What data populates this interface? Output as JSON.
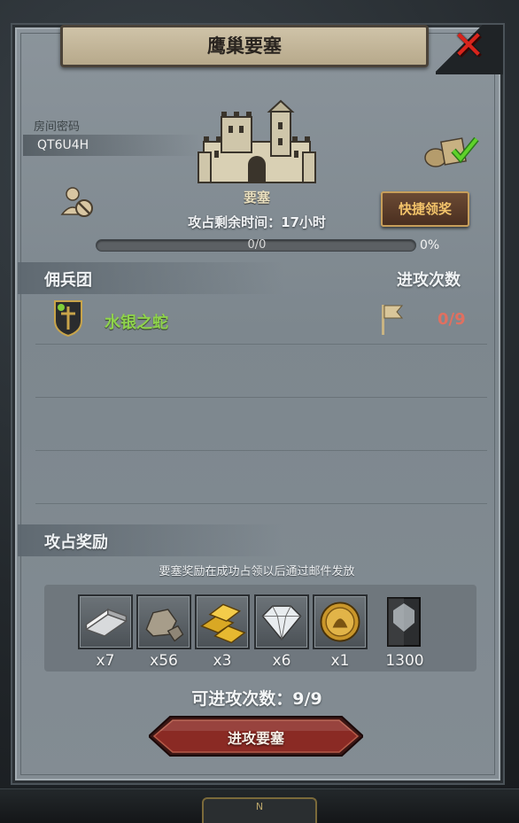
{
  "title": "鹰巢要塞",
  "room": {
    "label": "房间密码",
    "code": "QT6U4H"
  },
  "fortress": {
    "name": "要塞",
    "time_left": "攻占剩余时间：17小时"
  },
  "progress": {
    "text": "0/0",
    "percent_label": "0%",
    "fraction": 0
  },
  "quick_claim_label": "快捷领奖",
  "sections": {
    "mercenary": "佣兵团",
    "attack_count": "进攻次数",
    "rewards": "攻占奖励"
  },
  "guilds": [
    {
      "name": "水银之蛇",
      "attacks": "0/9",
      "name_color": "#8ed24c"
    }
  ],
  "reward_note": "要塞奖励在成功占领以后通过邮件发放",
  "rewards": [
    {
      "icon": "silver-ingot-icon",
      "qty": "x7"
    },
    {
      "icon": "stone-ore-icon",
      "qty": "x56"
    },
    {
      "icon": "gold-bars-icon",
      "qty": "x3"
    },
    {
      "icon": "diamond-icon",
      "qty": "x6"
    },
    {
      "icon": "gold-medal-icon",
      "qty": "x1"
    },
    {
      "icon": "guild-banner-icon",
      "qty": "1300"
    }
  ],
  "attacks_available": "可进攻次数：9/9",
  "attack_button_label": "进攻要塞",
  "colors": {
    "accent_gold": "#c79e5a",
    "close_red": "#d8241c",
    "guild_green": "#8ed24c",
    "count_red": "#e07060"
  }
}
